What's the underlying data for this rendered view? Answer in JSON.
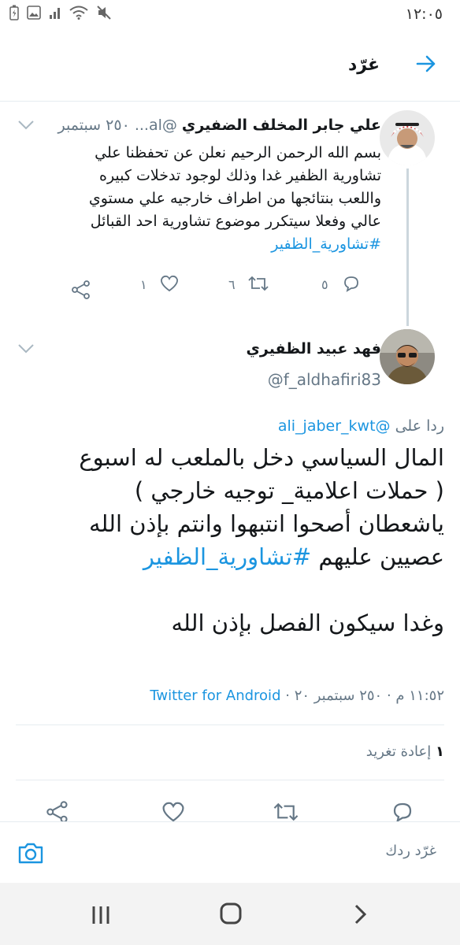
{
  "status_bar": {
    "time": "١٢:٠٥"
  },
  "header": {
    "title": "غرّد"
  },
  "parent_tweet": {
    "name": "علي جابر المخلف الضفيري",
    "handle": "@al...",
    "date": "٢٥٠ سبتمبر",
    "lines": [
      "بسم الله الرحمن الرحيم نعلن عن تحفظنا علي",
      "تشاورية الظفير غدا وذلك لوجود تدخلات كبيره",
      "واللعب بنتائجها من اطراف خارجيه علي مستوي",
      "عالي وفعلا سيتكرر موضوع تشاورية احد القبائل"
    ],
    "hashtag": "#تشاورية_الظفير",
    "reply_count": "٥",
    "retweet_count": "٦",
    "like_count": "١"
  },
  "main_tweet": {
    "name": "فهد عبيد الظفيري",
    "handle": "@f_aldhafiri83",
    "reply_to_prefix": "ردا على",
    "reply_to_handle": "@ali_jaber_kwt",
    "lines": [
      "المال السياسي دخل بالملعب له اسبوع",
      "( حملات اعلامية_ توجيه خارجي )",
      "ياشعطان أصحوا انتبهوا وانتم بإذن الله",
      "عصيين عليهم"
    ],
    "hashtag": "#تشاورية_الظفير",
    "last_line": "وغدا سيكون الفصل بإذن الله",
    "timestamp": "١١:٥٢ م · ٢٥٠ سبتمبر ٢٠",
    "source": "Twitter for Android",
    "retweet_count": "١",
    "retweet_label": "إعادة تغريد"
  },
  "reply_bar": {
    "placeholder": "غرّد ردك"
  },
  "colors": {
    "accent": "#1b95e0",
    "muted": "#657786",
    "divider": "#e6ecf0"
  }
}
